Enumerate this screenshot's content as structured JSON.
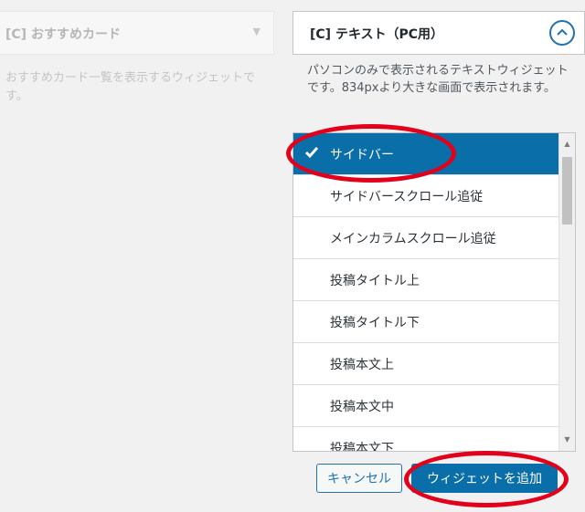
{
  "left_widget": {
    "title": "[C] おすすめカード",
    "description": "おすすめカード一覧を表示するウィジェットです。"
  },
  "right_widget": {
    "title": "[C] テキスト（PC用）",
    "description": "パソコンのみで表示されるテキストウィジェットです。834pxより大きな画面で表示されます。"
  },
  "sidebar_list": {
    "items": [
      {
        "label": "サイドバー",
        "selected": true
      },
      {
        "label": "サイドバースクロール追従",
        "selected": false
      },
      {
        "label": "メインカラムスクロール追従",
        "selected": false
      },
      {
        "label": "投稿タイトル上",
        "selected": false
      },
      {
        "label": "投稿タイトル下",
        "selected": false
      },
      {
        "label": "投稿本文上",
        "selected": false
      },
      {
        "label": "投稿本文中",
        "selected": false
      },
      {
        "label": "投稿本文下",
        "selected": false
      }
    ]
  },
  "actions": {
    "cancel_label": "キャンセル",
    "add_label": "ウィジェットを追加"
  },
  "colors": {
    "accent": "#0a6ea8",
    "annotation": "#e3001b"
  },
  "icons": {
    "toggle": "chevron-up-icon",
    "check": "checkmark-icon"
  }
}
